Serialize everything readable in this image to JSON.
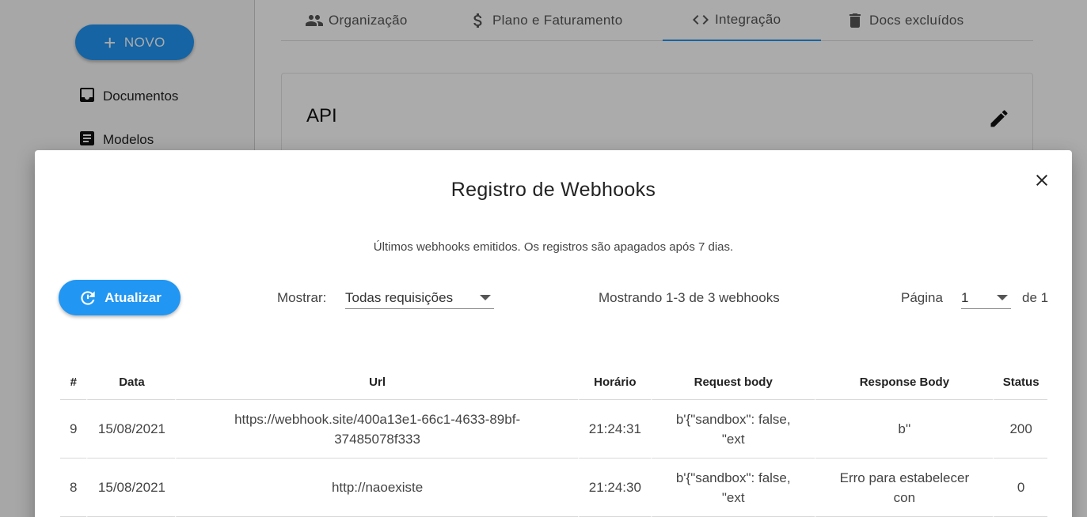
{
  "sidebar": {
    "new_button": "NOVO",
    "items": [
      {
        "label": "Documentos",
        "icon": "inbox-icon"
      },
      {
        "label": "Modelos",
        "icon": "document-icon"
      }
    ]
  },
  "tabs": [
    {
      "label": "Organização",
      "icon": "people-icon"
    },
    {
      "label": "Plano e Faturamento",
      "icon": "dollar-icon"
    },
    {
      "label": "Integração",
      "icon": "code-icon",
      "active": true
    },
    {
      "label": "Docs excluídos",
      "icon": "trash-icon"
    }
  ],
  "card": {
    "title": "API"
  },
  "modal": {
    "title": "Registro de Webhooks",
    "subtitle": "Últimos webhooks emitidos. Os registros são apagados após 7 dias.",
    "refresh_label": "Atualizar",
    "show_label": "Mostrar:",
    "show_value": "Todas requisições",
    "count_text": "Mostrando 1-3 de 3 webhooks",
    "page_label": "Página",
    "page_value": "1",
    "page_total": "de 1",
    "table": {
      "headers": [
        "#",
        "Data",
        "Url",
        "Horário",
        "Request body",
        "Response Body",
        "Status"
      ],
      "rows": [
        [
          "9",
          "15/08/2021",
          "https://webhook.site/400a13e1-66c1-4633-89bf-37485078f333",
          "21:24:31",
          "b'{\"sandbox\": false, \"ext",
          "b''",
          "200"
        ],
        [
          "8",
          "15/08/2021",
          "http://naoexiste",
          "21:24:30",
          "b'{\"sandbox\": false, \"ext",
          "Erro para estabelecer con",
          "0"
        ]
      ]
    }
  },
  "colors": {
    "accent": "#2196f3"
  }
}
